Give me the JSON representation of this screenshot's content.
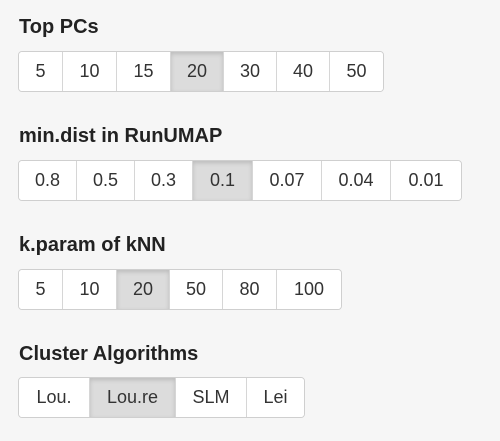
{
  "groups": [
    {
      "label": "Top PCs",
      "options": [
        "5",
        "10",
        "15",
        "20",
        "30",
        "40",
        "50"
      ],
      "selected": "20"
    },
    {
      "label": "min.dist in RunUMAP",
      "options": [
        "0.8",
        "0.5",
        "0.3",
        "0.1",
        "0.07",
        "0.04",
        "0.01"
      ],
      "selected": "0.1"
    },
    {
      "label": "k.param of kNN",
      "options": [
        "5",
        "10",
        "20",
        "50",
        "80",
        "100"
      ],
      "selected": "20"
    },
    {
      "label": "Cluster Algorithms",
      "options": [
        "Lou.",
        "Lou.re",
        "SLM",
        "Lei"
      ],
      "selected": "Lou.re"
    }
  ],
  "colors": {
    "background": "#f6f6f6",
    "button": "#ffffff",
    "button_active": "#dcdcdc",
    "border": "#cfcfcf",
    "text": "#222222"
  }
}
